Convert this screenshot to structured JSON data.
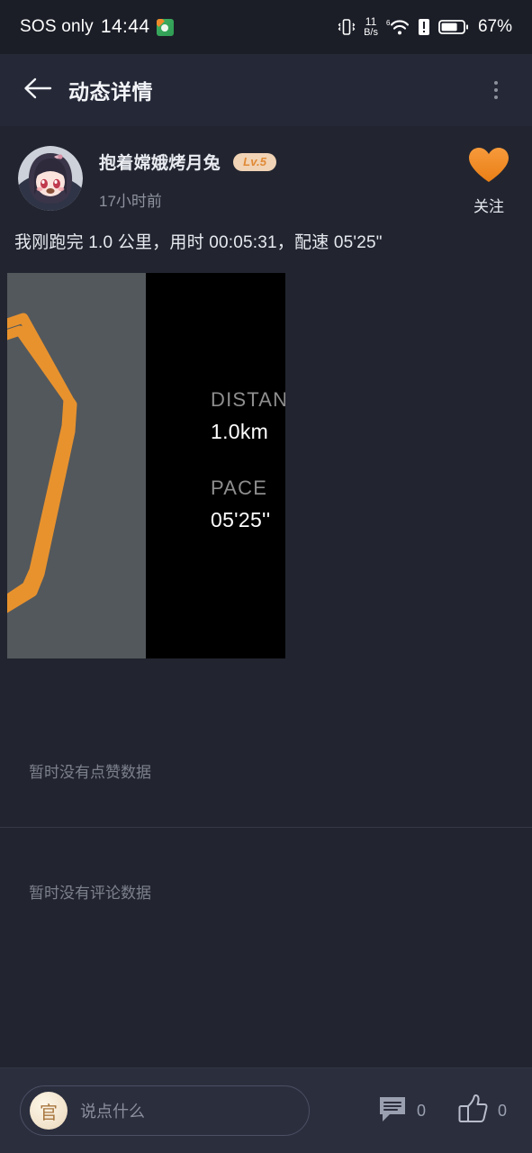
{
  "status_bar": {
    "carrier": "SOS only",
    "time": "14:44",
    "app_icon": "wechat-icon",
    "vibrate_icon": "vibrate-icon",
    "net_speed_value": "11",
    "net_speed_unit": "B/s",
    "wifi_icon": "wifi-6-icon",
    "sim_icon": "sim-alert-icon",
    "battery_icon": "battery-icon",
    "battery_percent": "67%"
  },
  "app_bar": {
    "back_icon": "back-arrow-icon",
    "title": "动态详情",
    "more_icon": "more-vertical-icon"
  },
  "post": {
    "avatar": "user-avatar-anime",
    "username": "抱着嫦娥烤月兔",
    "level_badge": "Lv.5",
    "time_ago": "17小时前",
    "follow": {
      "icon": "heart-icon",
      "label": "关注",
      "color": "#ef8a2c"
    },
    "text": "我刚跑完 1.0 公里，用时 00:05:31，配速 05'25\"",
    "media": {
      "map_route_color": "#e8922e",
      "map_bg_color": "#53585c",
      "panel_bg_color": "#000000",
      "stats": [
        {
          "label": "DISTANCE",
          "value": "1.0km"
        },
        {
          "label": "PACE",
          "value": "05'25''"
        }
      ]
    }
  },
  "likes_section": {
    "empty_text": "暂时没有点赞数据"
  },
  "comments_section": {
    "empty_text": "暂时没有评论数据"
  },
  "bottom_bar": {
    "mini_avatar_text": "官",
    "input_placeholder": "说点什么",
    "comment_icon": "comment-icon",
    "comment_count": "0",
    "like_icon": "thumbs-up-icon",
    "like_count": "0"
  }
}
